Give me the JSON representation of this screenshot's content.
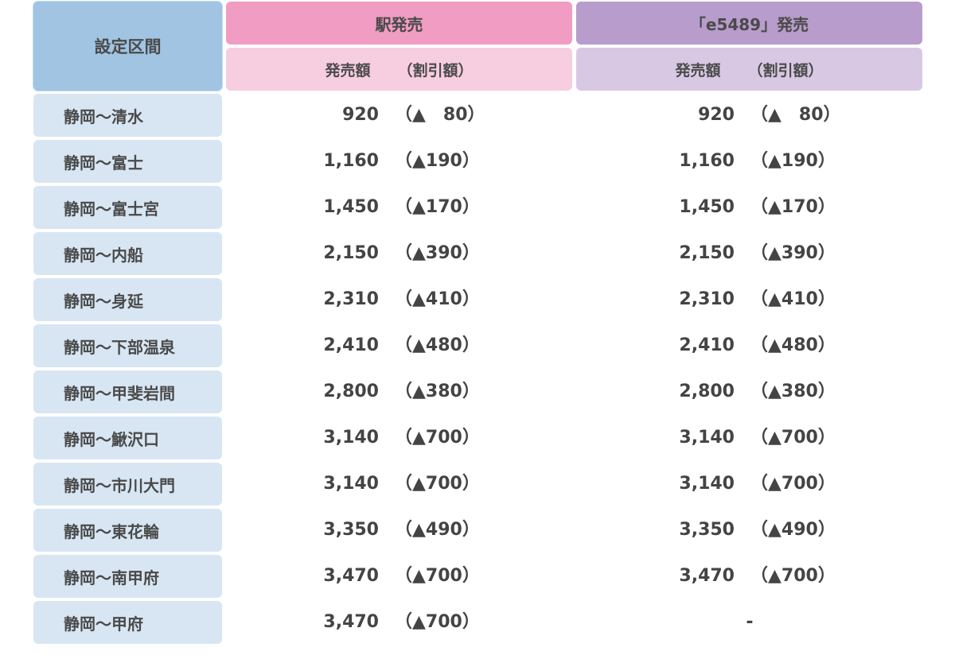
{
  "header": {
    "section_label": "設定区間",
    "station_sale": "駅発売",
    "e5489_sale": "「e5489」発売",
    "price_label": "発売額",
    "discount_label": "（割引額）"
  },
  "rows": [
    {
      "section": "静岡～清水",
      "station_price": "920",
      "station_discount": "（▲　80）",
      "e5489_price": "920",
      "e5489_discount": "（▲　80）"
    },
    {
      "section": "静岡～富士",
      "station_price": "1,160",
      "station_discount": "（▲190）",
      "e5489_price": "1,160",
      "e5489_discount": "（▲190）"
    },
    {
      "section": "静岡～富士宮",
      "station_price": "1,450",
      "station_discount": "（▲170）",
      "e5489_price": "1,450",
      "e5489_discount": "（▲170）"
    },
    {
      "section": "静岡～内船",
      "station_price": "2,150",
      "station_discount": "（▲390）",
      "e5489_price": "2,150",
      "e5489_discount": "（▲390）"
    },
    {
      "section": "静岡～身延",
      "station_price": "2,310",
      "station_discount": "（▲410）",
      "e5489_price": "2,310",
      "e5489_discount": "（▲410）"
    },
    {
      "section": "静岡～下部温泉",
      "station_price": "2,410",
      "station_discount": "（▲480）",
      "e5489_price": "2,410",
      "e5489_discount": "（▲480）"
    },
    {
      "section": "静岡～甲斐岩間",
      "station_price": "2,800",
      "station_discount": "（▲380）",
      "e5489_price": "2,800",
      "e5489_discount": "（▲380）"
    },
    {
      "section": "静岡～鰍沢口",
      "station_price": "3,140",
      "station_discount": "（▲700）",
      "e5489_price": "3,140",
      "e5489_discount": "（▲700）"
    },
    {
      "section": "静岡～市川大門",
      "station_price": "3,140",
      "station_discount": "（▲700）",
      "e5489_price": "3,140",
      "e5489_discount": "（▲700）"
    },
    {
      "section": "静岡～東花輪",
      "station_price": "3,350",
      "station_discount": "（▲490）",
      "e5489_price": "3,350",
      "e5489_discount": "（▲490）"
    },
    {
      "section": "静岡～南甲府",
      "station_price": "3,470",
      "station_discount": "（▲700）",
      "e5489_price": "3,470",
      "e5489_discount": "（▲700）"
    },
    {
      "section": "静岡～甲府",
      "station_price": "3,470",
      "station_discount": "（▲700）",
      "e5489_price": "",
      "e5489_discount": "",
      "e5489_unavailable": "-"
    }
  ]
}
